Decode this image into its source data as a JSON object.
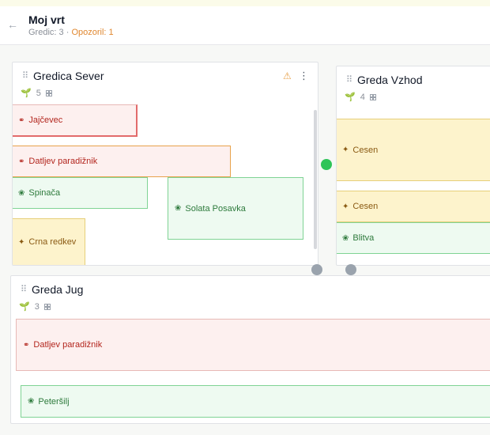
{
  "header": {
    "title": "Moj vrt",
    "beds_label": "Gredic: 3",
    "separator": "·",
    "warnings_label": "Opozoril: 1"
  },
  "beds": [
    {
      "name": "Gredica Sever",
      "plant_count": "5",
      "plants": [
        {
          "label": "Jajčevec"
        },
        {
          "label": "Datljev paradižnik"
        },
        {
          "label": "Spinača"
        },
        {
          "label": "Solata Posavka"
        },
        {
          "label": "Crna redkev"
        }
      ]
    },
    {
      "name": "Greda Vzhod",
      "plant_count": "4",
      "plants": [
        {
          "label": "Cesen"
        },
        {
          "label": "Cesen"
        },
        {
          "label": "Blitva"
        }
      ]
    },
    {
      "name": "Greda Jug",
      "plant_count": "3",
      "plants": [
        {
          "label": "Datljev paradižnik"
        },
        {
          "label": "Peteršilj"
        }
      ]
    }
  ],
  "colors": {
    "tomato_red": "#b3261e",
    "leaf_green": "#2d7a3c",
    "root_yellow": "#8a5a13",
    "warning_orange": "#e8a24b",
    "status_green": "#2ec458"
  },
  "icons": {
    "back": "arrow-left-icon",
    "warning": "warning-triangle-icon",
    "menu": "more-vertical-icon",
    "count": "sprout-icon",
    "layout": "grid-icon"
  }
}
